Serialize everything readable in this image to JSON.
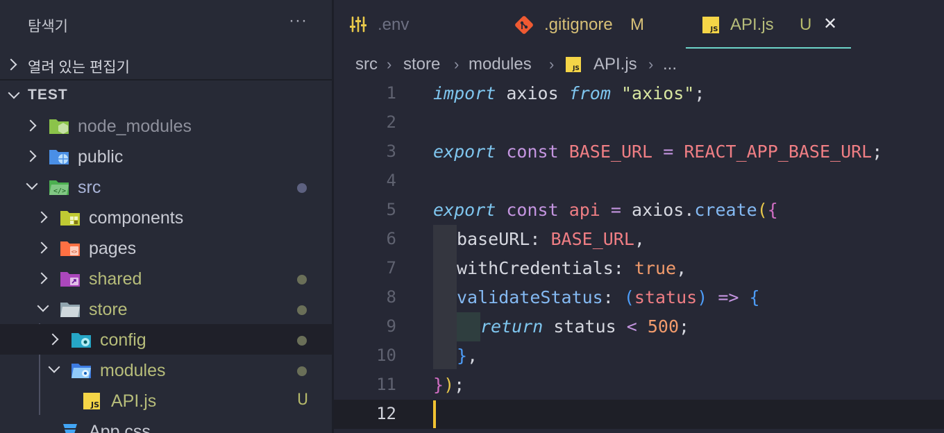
{
  "sidebar": {
    "title": "탐색기",
    "more": "···",
    "open_editors": "열려 있는 편집기",
    "workspace": "TEST",
    "tree": [
      {
        "label": "node_modules",
        "status": ""
      },
      {
        "label": "public",
        "status": ""
      },
      {
        "label": "src",
        "status": "dot"
      },
      {
        "label": "components",
        "status": ""
      },
      {
        "label": "pages",
        "status": ""
      },
      {
        "label": "shared",
        "status": "dot"
      },
      {
        "label": "store",
        "status": "dot"
      },
      {
        "label": "config",
        "status": "dot"
      },
      {
        "label": "modules",
        "status": "dot"
      },
      {
        "label": "API.js",
        "status": "U"
      },
      {
        "label": "App.css",
        "status": ""
      }
    ]
  },
  "tabs": [
    {
      "label": ".env",
      "badge": ""
    },
    {
      "label": ".gitignore",
      "badge": "M"
    },
    {
      "label": "API.js",
      "badge": "U",
      "close": "✕",
      "icon_text": "JS"
    }
  ],
  "breadcrumb": {
    "items": [
      "src",
      "store",
      "modules",
      "API.js",
      "..."
    ],
    "sep": "›",
    "icon_text": "JS"
  },
  "code": {
    "line_numbers": [
      "1",
      "2",
      "3",
      "4",
      "5",
      "6",
      "7",
      "8",
      "9",
      "10",
      "11",
      "12"
    ],
    "tokens": {
      "import": "import",
      "axios_id": "axios",
      "from": "from",
      "axios_str": "\"axios\"",
      "semi": ";",
      "export": "export",
      "const": "const",
      "base_url": "BASE_URL",
      "eq": "=",
      "react_env": "REACT_APP_BASE_URL",
      "api": "api",
      "dot": ".",
      "create": "create",
      "lparen": "(",
      "lbrace": "{",
      "baseURL_key": "baseURL",
      "colon": ":",
      "comma": ",",
      "withCredentials": "withCredentials",
      "true": "true",
      "validateStatus": "validateStatus",
      "status_param": "status",
      "arrow": "=>",
      "return": "return",
      "status": "status",
      "lt": "<",
      "num": "500",
      "rbrace": "}",
      "rparen": ")"
    }
  },
  "colors": {
    "accent": "#6dd4c9",
    "modified": "#d7c077",
    "untracked": "#b6ba6b",
    "cursor": "#f1c232"
  }
}
